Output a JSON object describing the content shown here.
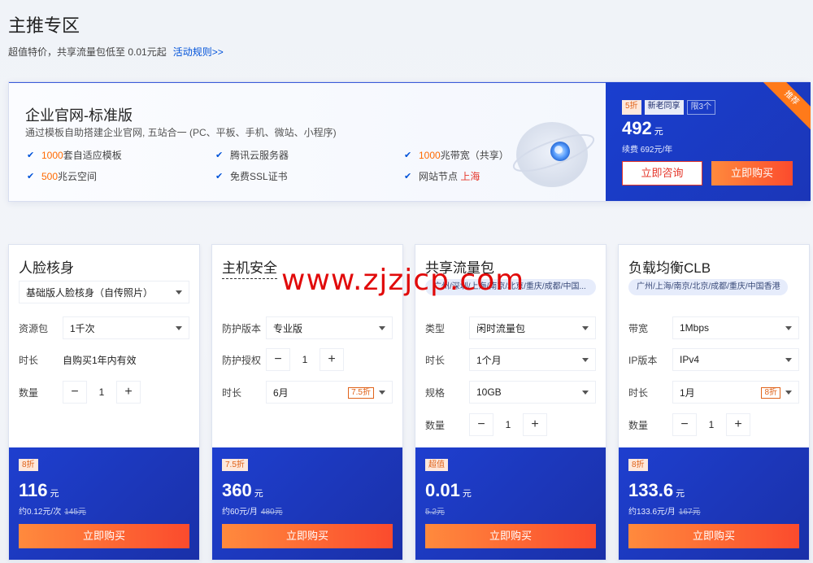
{
  "section": {
    "title": "主推专区",
    "subtitle": "超值特价，共享流量包低至 0.01元起",
    "rules_link": "活动规则>>"
  },
  "banner": {
    "title": "企业官网-标准版",
    "desc": "通过模板自助搭建企业官网, 五站合一 (PC、平板、手机、微站、小程序)",
    "features": {
      "f1_hl": "1000",
      "f1_text": "套自适应模板",
      "f2_text": "腾讯云服务器",
      "f3_hl": "1000",
      "f3_text": "兆带宽（共享）",
      "f4_hl": "500",
      "f4_text": "兆云空间",
      "f5_text": "免费SSL证书",
      "f6_text": "网站节点",
      "f6_hl": "上海"
    },
    "ribbon": "推荐",
    "tag_discount": "5折",
    "tag_new": "新老同享",
    "tag_limit": "限3个",
    "price": "492",
    "price_unit": "元",
    "renew": "续费 692元/年",
    "consult_label": "立即咨询",
    "buy_label": "立即购买"
  },
  "cards": [
    {
      "title": "人脸核身",
      "top_select": "基础版人脸核身（自传照片）",
      "r1_label": "资源包",
      "r1_value": "1千次",
      "r2_label": "时长",
      "r2_value": "自购买1年内有效",
      "r3_label": "数量",
      "r3_value": "1",
      "tag": "8折",
      "price": "116",
      "price_unit": "元",
      "unit_price": "约0.12元/次",
      "orig": "145元",
      "buy_label": "立即购买"
    },
    {
      "title": "主机安全",
      "r1_label": "防护版本",
      "r1_value": "专业版",
      "r2_label": "防护授权",
      "r2_value": "1",
      "r3_label": "时长",
      "r3_value": "6月",
      "r3_disc": "7.5折",
      "tag": "7.5折",
      "price": "360",
      "price_unit": "元",
      "unit_price": "约60元/月",
      "orig": "480元",
      "buy_label": "立即购买"
    },
    {
      "title": "共享流量包",
      "regions": "广州/深圳/上海/南京/北京/重庆/成都/中国...",
      "r1_label": "类型",
      "r1_value": "闲时流量包",
      "r2_label": "时长",
      "r2_value": "1个月",
      "r3_label": "规格",
      "r3_value": "10GB",
      "r4_label": "数量",
      "r4_value": "1",
      "tag": "超值",
      "price": "0.01",
      "price_unit": "元",
      "orig": "5.2元",
      "buy_label": "立即购买"
    },
    {
      "title": "负载均衡CLB",
      "regions": "广州/上海/南京/北京/成都/重庆/中国香港",
      "r1_label": "带宽",
      "r1_value": "1Mbps",
      "r2_label": "IP版本",
      "r2_value": "IPv4",
      "r3_label": "时长",
      "r3_value": "1月",
      "r3_disc": "8折",
      "r4_label": "数量",
      "r4_value": "1",
      "tag": "8折",
      "price": "133.6",
      "price_unit": "元",
      "unit_price": "约133.6元/月",
      "orig": "167元",
      "buy_label": "立即购买"
    }
  ],
  "stepper": {
    "minus": "−",
    "plus": "+"
  },
  "watermark": "www.zjzjcp.com",
  "colors": {
    "brand_blue": "#1b3fcf",
    "accent_orange": "#ff6a00",
    "buy_gradient_start": "#ff8a3d",
    "buy_gradient_end": "#fb4b2d"
  }
}
